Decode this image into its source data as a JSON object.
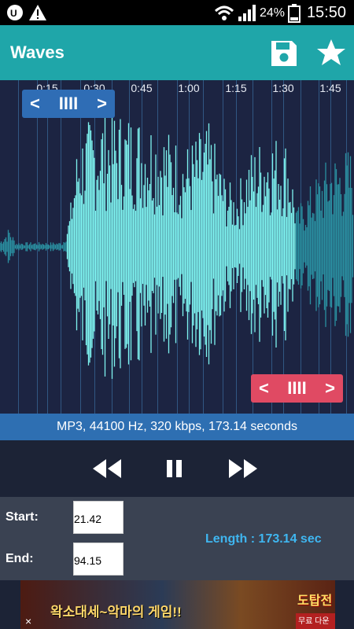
{
  "status_bar": {
    "battery_percent": "24%",
    "time": "15:50"
  },
  "app_bar": {
    "title": "Waves"
  },
  "timeline": {
    "ticks": [
      "0:15",
      "0:30",
      "0:45",
      "1:00",
      "1:15",
      "1:30",
      "1:45"
    ]
  },
  "handles": {
    "start_grip": "IIII",
    "end_grip": "IIII",
    "left_arrow": "<",
    "right_arrow": ">"
  },
  "file_info": "MP3, 44100 Hz, 320 kbps, 173.14 seconds",
  "trim": {
    "start_label": "Start:",
    "start_value": "21.42",
    "end_label": "End:",
    "end_value": "94.15",
    "length_text": "Length : 173.14 sec"
  },
  "ad": {
    "text": "왁소대세~악마의 게임!!",
    "logo": "도탑전",
    "logo_sub": "무료 다운로드",
    "close": "×"
  },
  "colors": {
    "app_bar": "#1fa6a9",
    "wave": "#7ff4f0",
    "start_handle": "#2f6db5",
    "end_handle": "#e04a63",
    "length_text": "#3fb6f0"
  }
}
